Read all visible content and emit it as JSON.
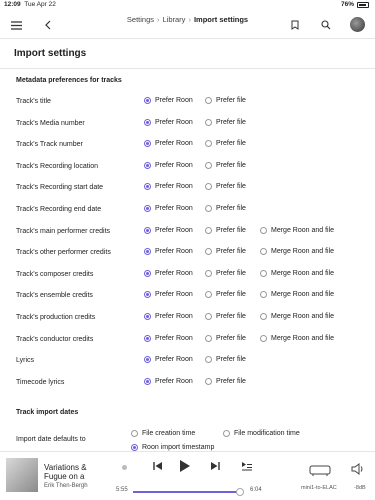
{
  "statusbar": {
    "time": "12:09",
    "date": "Tue Apr 22",
    "battery": "76%"
  },
  "breadcrumb": {
    "items": [
      "Settings",
      "Library",
      "Import settings"
    ]
  },
  "page_title": "Import settings",
  "metadata_section": {
    "title": "Metadata preferences for tracks",
    "option_labels": {
      "roon": "Prefer Roon",
      "file": "Prefer file",
      "merge": "Merge Roon and file"
    },
    "rows": [
      {
        "label": "Track's title",
        "selected": "roon",
        "has_merge": false
      },
      {
        "label": "Track's Media number",
        "selected": "roon",
        "has_merge": false
      },
      {
        "label": "Track's Track number",
        "selected": "roon",
        "has_merge": false
      },
      {
        "label": "Track's Recording location",
        "selected": "roon",
        "has_merge": false
      },
      {
        "label": "Track's Recording start date",
        "selected": "roon",
        "has_merge": false
      },
      {
        "label": "Track's Recording end date",
        "selected": "roon",
        "has_merge": false
      },
      {
        "label": "Track's main performer credits",
        "selected": "roon",
        "has_merge": true
      },
      {
        "label": "Track's other performer credits",
        "selected": "roon",
        "has_merge": true
      },
      {
        "label": "Track's composer credits",
        "selected": "roon",
        "has_merge": true
      },
      {
        "label": "Track's ensemble credits",
        "selected": "roon",
        "has_merge": true
      },
      {
        "label": "Track's production credits",
        "selected": "roon",
        "has_merge": true
      },
      {
        "label": "Track's conductor credits",
        "selected": "roon",
        "has_merge": true
      },
      {
        "label": "Lyrics",
        "selected": "roon",
        "has_merge": false
      },
      {
        "label": "Timecode lyrics",
        "selected": "roon",
        "has_merge": false
      }
    ]
  },
  "dates_section": {
    "title": "Track import dates",
    "row_label": "Import date defaults to",
    "options": [
      {
        "label": "File creation time",
        "selected": false
      },
      {
        "label": "File modification time",
        "selected": false
      },
      {
        "label": "Roon import timestamp",
        "selected": true
      }
    ]
  },
  "now_playing": {
    "title": "Variations & Fugue on a",
    "artist": "Erik Then-Bergh",
    "elapsed": "5:55",
    "total": "6:04",
    "progress": 0.975,
    "zone": "mini1-to-ELAC",
    "volume": "-8dB"
  },
  "colors": {
    "accent": "#6f62d8"
  },
  "icons": [
    "menu-icon",
    "back-icon",
    "bookmark-icon",
    "search-icon",
    "prev-icon",
    "play-icon",
    "next-icon",
    "queue-icon",
    "speaker-icon",
    "volume-icon"
  ]
}
